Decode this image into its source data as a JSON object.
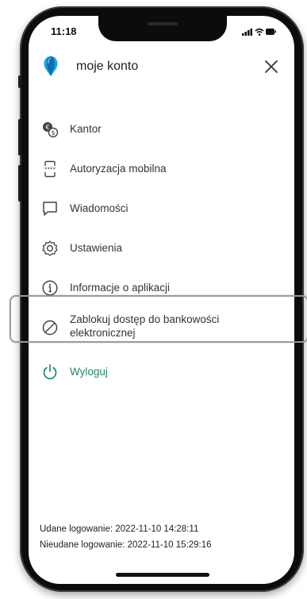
{
  "status": {
    "time": "11:18"
  },
  "header": {
    "title": "moje konto"
  },
  "menu": [
    {
      "label": "Kantor",
      "icon": "currency-exchange-icon"
    },
    {
      "label": "Autoryzacja mobilna",
      "icon": "mobile-authorization-icon"
    },
    {
      "label": "Wiadomości",
      "icon": "message-icon"
    },
    {
      "label": "Ustawienia",
      "icon": "gear-icon"
    },
    {
      "label": "Informacje o aplikacji",
      "icon": "info-icon"
    },
    {
      "label_line1": "Zablokuj dostęp do bankowości",
      "label_line2": "elektronicznej",
      "icon": "block-icon"
    },
    {
      "label": "Wyloguj",
      "icon": "power-icon",
      "color": "#1e8a5b"
    }
  ],
  "footer": {
    "success_login": "Udane logowanie: 2022-11-10 14:28:11",
    "failed_login": "Nieudane logowanie: 2022-11-10 15:29:16"
  },
  "colors": {
    "accent_green": "#1e8a5b",
    "logo_blue": "#1aa3e8"
  }
}
